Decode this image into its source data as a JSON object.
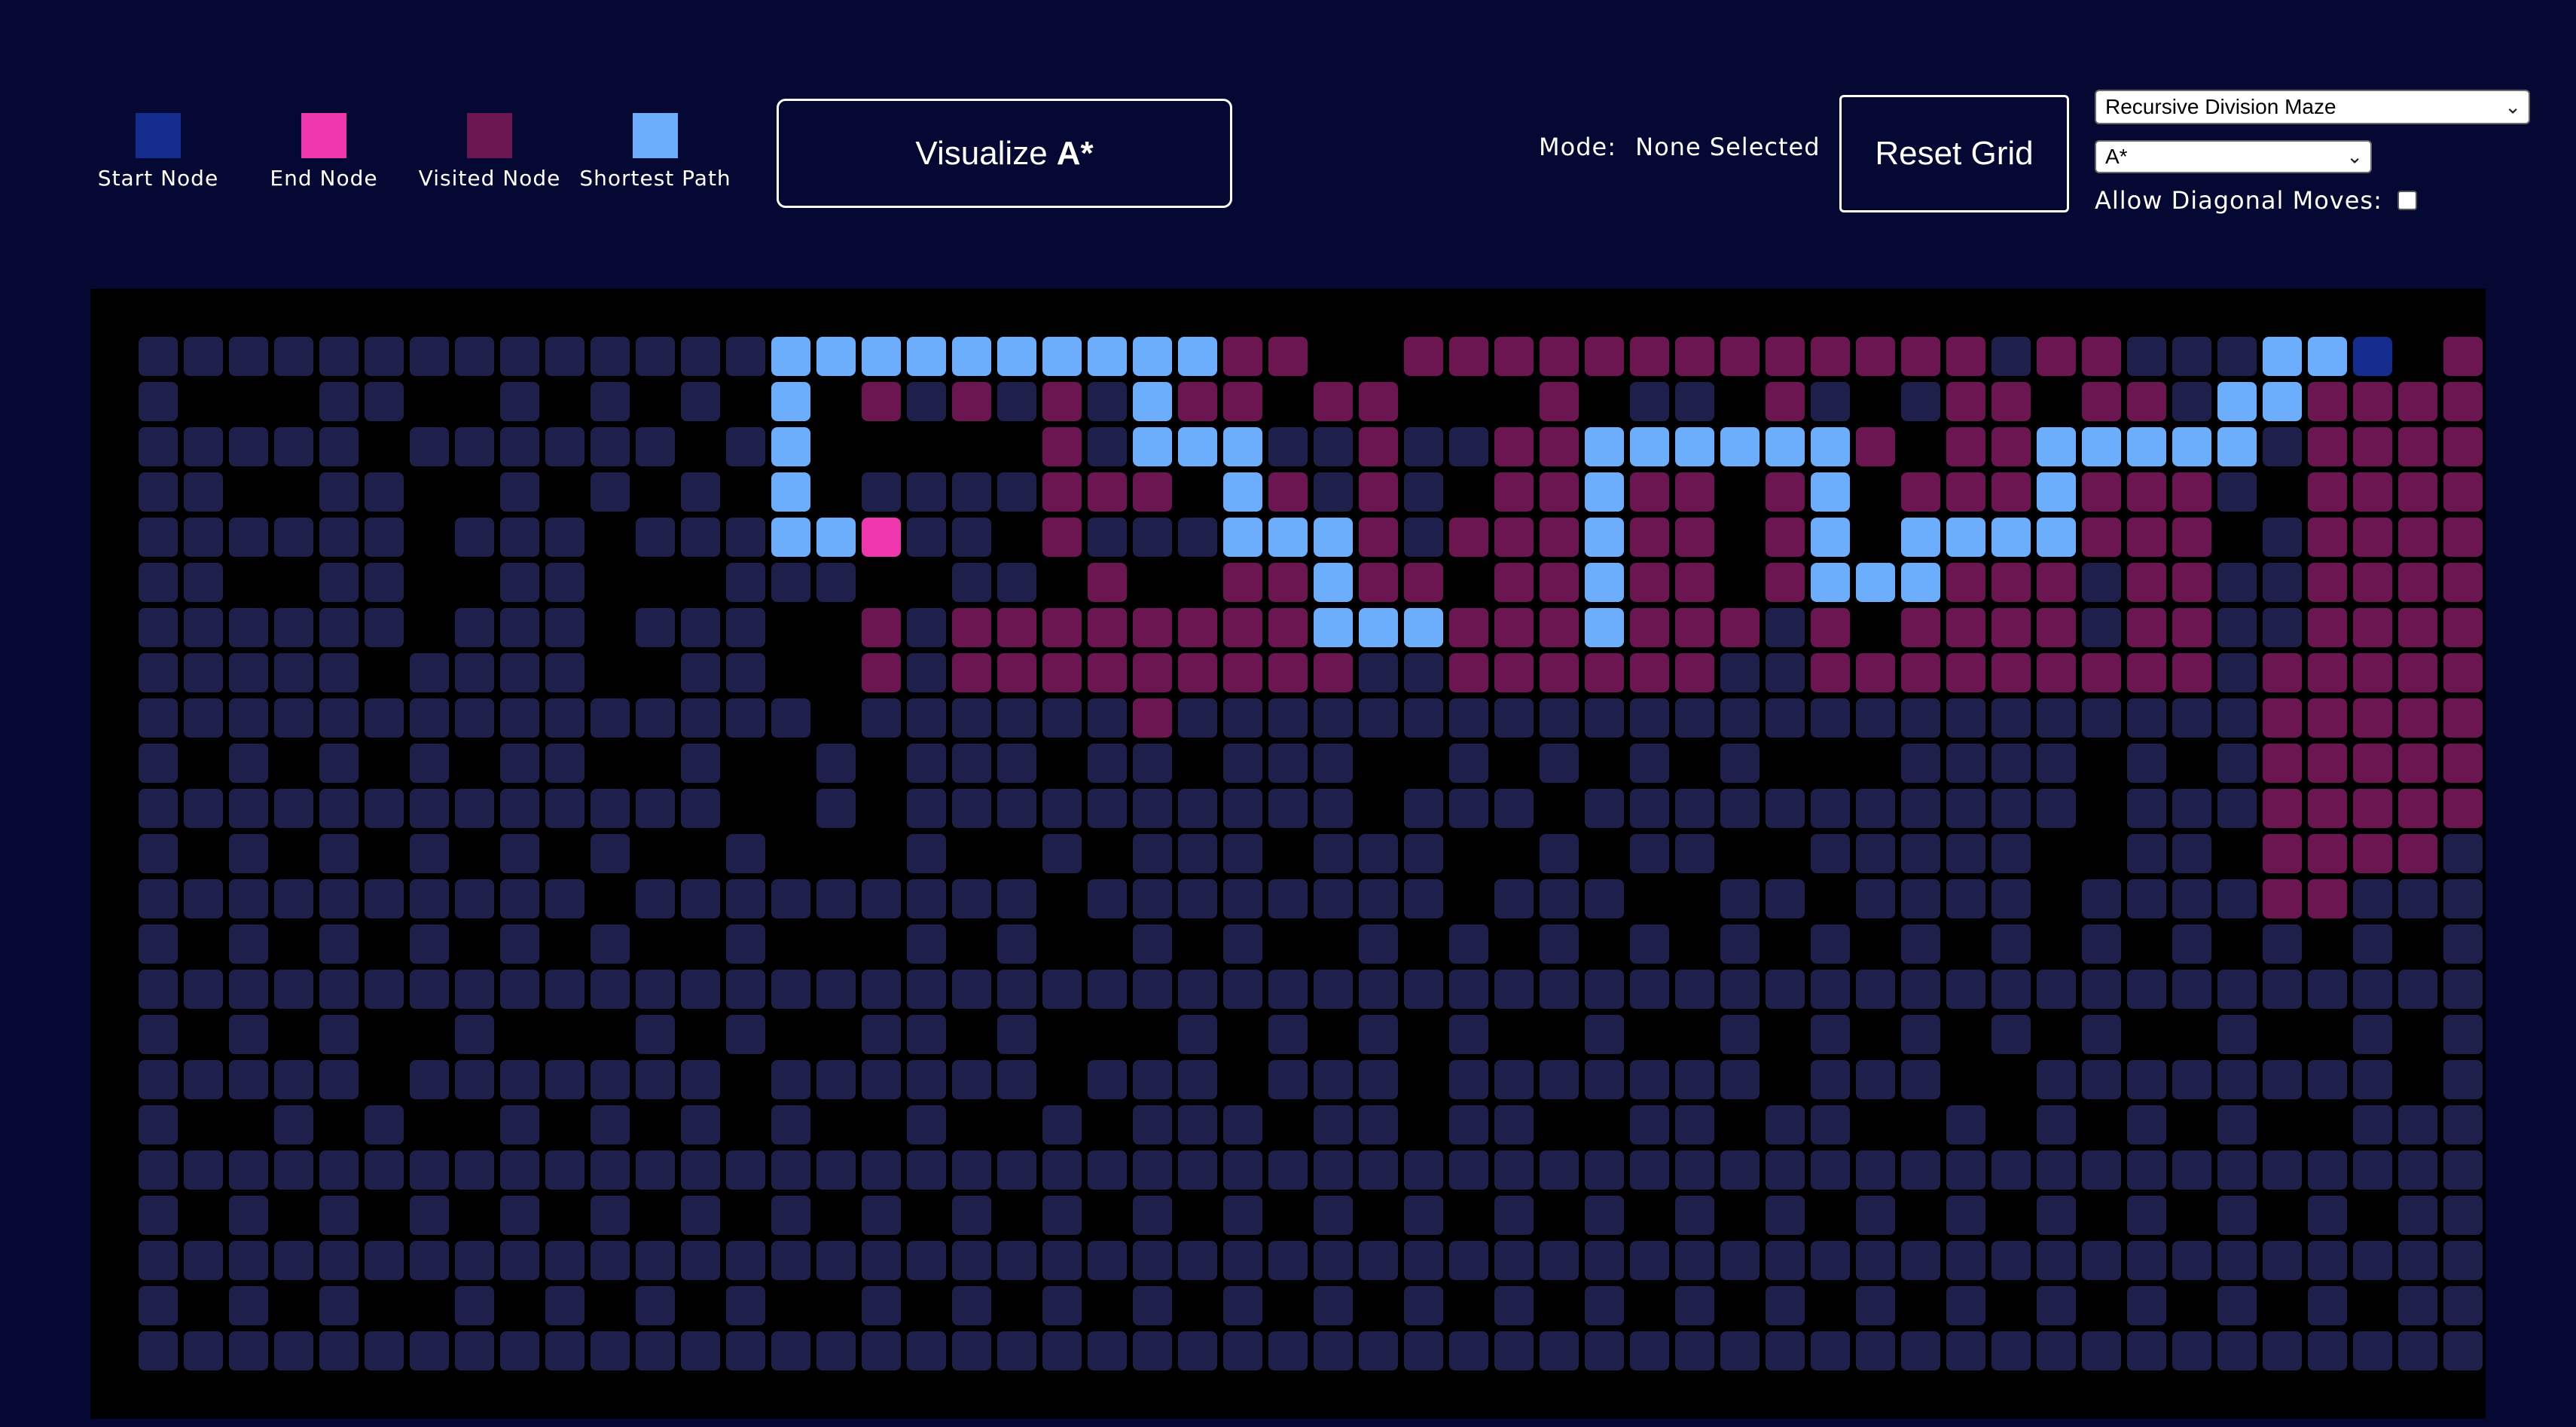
{
  "legend": [
    {
      "label": "Start Node",
      "color": "#152c8f"
    },
    {
      "label": "End Node",
      "color": "#ee36ad"
    },
    {
      "label": "Visited Node",
      "color": "#6b1551"
    },
    {
      "label": "Shortest Path",
      "color": "#6daefc"
    }
  ],
  "visualize_button": {
    "prefix": "Visualize",
    "algorithm": "A*"
  },
  "mode": {
    "label": "Mode:",
    "value": "None Selected"
  },
  "reset_button": {
    "label": "Reset Grid"
  },
  "maze_select": {
    "selected": "Recursive Division Maze"
  },
  "algorithm_select": {
    "selected": "A*"
  },
  "diagonal": {
    "label": "Allow Diagonal Moves:",
    "checked": false
  },
  "colors": {
    "background": "#050832",
    "wall": "#000000",
    "unvisited": "#1e1f4a",
    "visited": "#6b1551",
    "path": "#6daefc",
    "start": "#152c8f",
    "end": "#ee36ad"
  },
  "grid": {
    "cols": 53,
    "rows": 25,
    "start": [
      50,
      1
    ],
    "end": [
      17,
      5
    ],
    "open_cells": [
      "1-14,23-26,29,31-38,40-49,52-53;1",
      "1,5-6,9,11,13,15,17-18,20,22,25,27-28,32,34-35,38,40-42,44-50,52-53;2",
      "1-5,7-12,14-15,22-23,25-30,32-33,36-37,39,41-42,44-53;3",
      "1-2,5-6,9,11,13,15,17-20,22-23,25,27,29,31-32,34-35,40-41,43-44,46-47,49,51-53;4",
      "1-6,8-10,12-14,18-19,21-26,28-31,33-35,37-38,40-42,44-46,48-53;5",
      "1-2,5-6,9-10,14-16,19-20,22,28,31,33,35,37,40-41,43-44,47-48,51-53;6",
      "1-6,8-10,12-14,18-19,21-22,28-30,32-34,36-37,40-44,46-53;7",
      "1-5,7-10,13-14,18-19,28-30,32-34,36-37,41-44,46-48,50-53;8",
      "1-15,17-47,49-53;9",
      "1,3,5,7,9-10,13,16,18-20,22-23,25-27,30,32,34,36,40-43,45,47,49,52-53;10",
      "1-13,16,18-27,29-31,33-43,45-53;11",
      "1,3,5,7,9,11,14,18,21,23-25,27-29,32,34-35,38-42,45-46,49-50,52-53;12",
      "1-10,12-20,22-29,31-33,36-37,39-42,44-53;13",
      "1,3,5,7,9,11,14,18,20,23,25,28,30,32,34,36,38,40,42,44,46,48,50,52-53;14",
      "1-53;15",
      "1,3,5,8,12,14,17-18,20,24,26,28,30,33,36,38,40,42,44,47,50,52-53;16",
      "1-5,7-13,15-20,22-24,26-28,30-36,38-40,43-50,52-53;17",
      "1,4,6,9,11,13,15,18,21,23-25,27-28,30-31,34-35,37-38,41,43,45,47,50-53;18",
      "1-53;19",
      "1,3,5,7,9,11,13,15,17,19,21,23,25,27,29,31,33,35,37,39,41,43,45,47,49,51-53;20",
      "1-53;21",
      "1,3,5,8,10,12,14,17,19,21,23,25,27,29,31,33,35,37,39,41,43,45,47,49,51-53;22",
      "1-53;23"
    ],
    "visited_cells": [
      "24-26,29-41,43-44,52;1",
      "17,19,21,24-25,27-28,32,37,41-42,44-45,49-53;2",
      "21,24-25,28,31-33,36-37,39,41-42,44-46,49-53;3",
      "21-23,26,28,31-32,34-35,37-38,40-42,44-46,49-53;4",
      "21,25-26,28,30-32,34-35,37-38,40-42,44-46,49-53;5",
      "22,25-26,28-29,31-32,34-35,37-38,40-43,45-46,49-53;6",
      "17,19-27,29-36,38,40-43,45-46,49-53;7",
      "17,19-27,30-35,38-46,48-53;8",
      "23,48-53;9",
      "48-53;10",
      "48-53;11",
      "48-51;12",
      "48-49;13"
    ],
    "path_cells": [
      "15-24,48-50;1",
      "15,23,47-48;2",
      "15,23-25,33-38,43-47;3",
      "15,25,33,38,43;4",
      "15-16,25-27,33,38,40-43;5",
      "27,33,38-40;6",
      "27-29,33;7"
    ]
  }
}
